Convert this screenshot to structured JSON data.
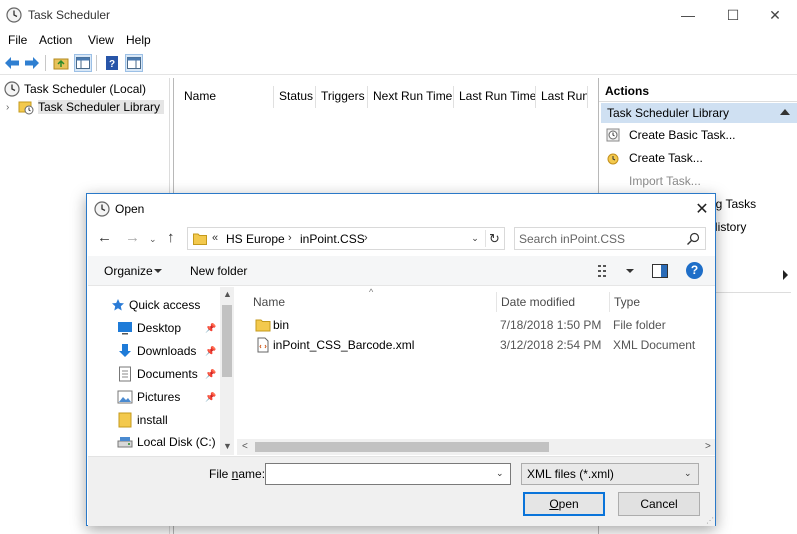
{
  "main_window": {
    "title": "Task Scheduler",
    "controls": {
      "minimize": "—",
      "maximize": "☐",
      "close": "✕"
    },
    "menu": [
      "File",
      "Action",
      "View",
      "Help"
    ],
    "tree": {
      "root": "Task Scheduler (Local)",
      "library": "Task Scheduler Library"
    },
    "columns": [
      "Name",
      "Status",
      "Triggers",
      "Next Run Time",
      "Last Run Time",
      "Last Run R"
    ],
    "actions": {
      "title": "Actions",
      "section": "Task Scheduler Library",
      "items": [
        {
          "label": "Create Basic Task...",
          "icon": "basic-task-icon",
          "enabled": true
        },
        {
          "label": "Create Task...",
          "icon": "create-task-icon",
          "enabled": true
        },
        {
          "label": "Import Task...",
          "icon": "",
          "enabled": false
        },
        {
          "label": "ng Tasks",
          "icon": "",
          "enabled": true
        },
        {
          "label": "History",
          "icon": "",
          "enabled": true
        }
      ]
    }
  },
  "open_dialog": {
    "title": "Open",
    "close": "✕",
    "address": {
      "overflow": "«",
      "crumbs": [
        "HS Europe",
        "inPoint.CSS"
      ],
      "separator": "›"
    },
    "search_placeholder": "Search inPoint.CSS",
    "command_bar": {
      "organize": "Organize",
      "new_folder": "New folder",
      "help": "?"
    },
    "nav_items": [
      {
        "label": "Quick access",
        "icon": "star-icon",
        "pinned": false
      },
      {
        "label": "Desktop",
        "icon": "desktop-icon",
        "pinned": true
      },
      {
        "label": "Downloads",
        "icon": "download-icon",
        "pinned": true
      },
      {
        "label": "Documents",
        "icon": "documents-icon",
        "pinned": true
      },
      {
        "label": "Pictures",
        "icon": "pictures-icon",
        "pinned": true
      },
      {
        "label": "install",
        "icon": "folder-icon",
        "pinned": false
      },
      {
        "label": "Local Disk (C:)",
        "icon": "disk-icon",
        "pinned": false
      }
    ],
    "file_columns": {
      "name": "Name",
      "date": "Date modified",
      "type": "Type"
    },
    "files": [
      {
        "name": "bin",
        "date": "7/18/2018 1:50 PM",
        "type": "File folder",
        "icon": "folder-icon"
      },
      {
        "name": "inPoint_CSS_Barcode.xml",
        "date": "3/12/2018 2:54 PM",
        "type": "XML Document",
        "icon": "xml-file-icon"
      }
    ],
    "file_name_label_pre": "File ",
    "file_name_label_u": "n",
    "file_name_label_post": "ame:",
    "file_name_value": "",
    "file_type": "XML files (*.xml)",
    "open_button_u": "O",
    "open_button_rest": "pen",
    "cancel_button": "Cancel"
  },
  "colors": {
    "accent_blue": "#0a74da",
    "selection": "#cfe0f2",
    "folder_yellow": "#f3c94d"
  }
}
